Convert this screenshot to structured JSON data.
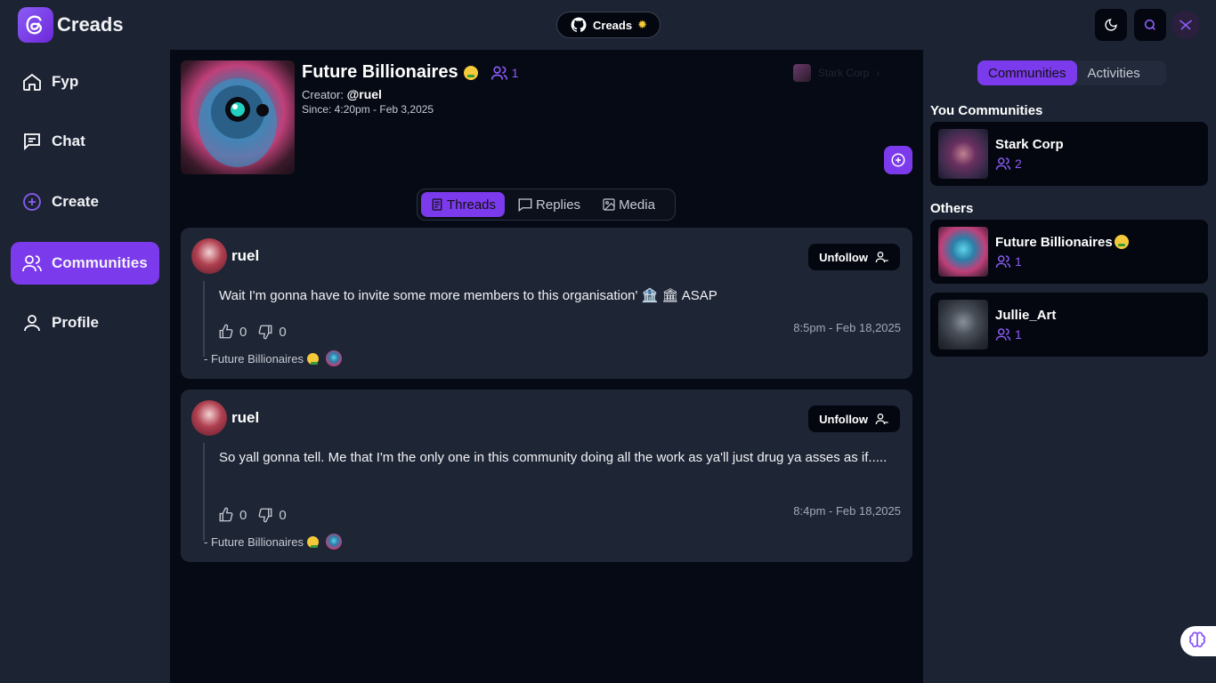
{
  "app": {
    "name": "Creads"
  },
  "header": {
    "github_label": "Creads",
    "theme_icon": "moon-icon",
    "search_icon": "search-icon"
  },
  "sidebar": {
    "items": [
      {
        "label": "Fyp",
        "icon": "home-icon"
      },
      {
        "label": "Chat",
        "icon": "chat-icon"
      },
      {
        "label": "Create",
        "icon": "plus-circle-icon"
      },
      {
        "label": "Communities",
        "icon": "users-icon",
        "active": true
      },
      {
        "label": "Profile",
        "icon": "user-icon"
      }
    ]
  },
  "community": {
    "title": "Future Billionaires",
    "members": "1",
    "creator_label": "Creator:",
    "creator": "@ruel",
    "since": "Since: 4:20pm - Feb 3,2025",
    "owner_name": "Stark Corp"
  },
  "tabs": [
    {
      "label": "Threads",
      "active": true
    },
    {
      "label": "Replies"
    },
    {
      "label": "Media"
    }
  ],
  "posts": [
    {
      "user": "ruel",
      "follow_label": "Unfollow",
      "text": "Wait I'm gonna have to invite some more members to this organisation' 🏦 🏛 ASAP",
      "likes": "0",
      "dislikes": "0",
      "time": "8:5pm - Feb 18,2025",
      "community": "- Future Billionaires"
    },
    {
      "user": "ruel",
      "follow_label": "Unfollow",
      "text": " So yall gonna tell. Me that I'm the only one in this community doing all the work as ya'll just drug ya asses as if.....",
      "likes": "0",
      "dislikes": "0",
      "time": "8:4pm - Feb 18,2025",
      "community": "- Future Billionaires"
    }
  ],
  "rightbar": {
    "tabs": [
      {
        "label": "Communities",
        "active": true
      },
      {
        "label": "Activities"
      }
    ],
    "your_heading": "You Communities",
    "others_heading": "Others",
    "your_communities": [
      {
        "name": "Stark Corp",
        "members": "2"
      }
    ],
    "others": [
      {
        "name": "Future Billionaires",
        "members": "1"
      },
      {
        "name": "Jullie_Art",
        "members": "1"
      }
    ]
  },
  "colors": {
    "accent": "#7c3aed",
    "bg": "#060a14",
    "panel": "#1c2333",
    "card": "#1e2535"
  }
}
